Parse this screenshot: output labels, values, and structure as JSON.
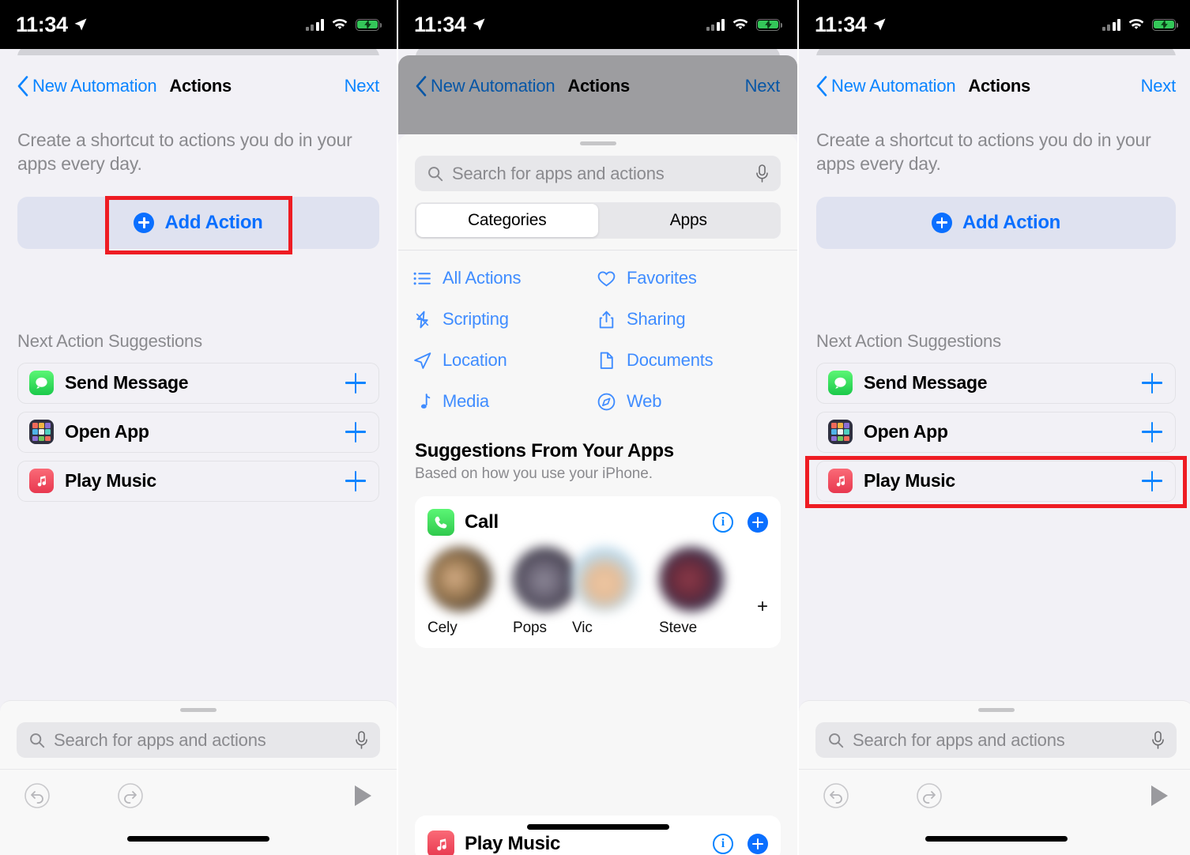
{
  "status_bar": {
    "time": "11:34",
    "icons": [
      "location-arrow-icon",
      "cellular-signal-icon",
      "wifi-icon",
      "battery-charging-icon"
    ]
  },
  "nav": {
    "back_label": "New Automation",
    "title": "Actions",
    "next_label": "Next"
  },
  "panel1": {
    "intro": "Create a shortcut to actions you do in your apps every day.",
    "add_action_label": "Add Action",
    "section_label": "Next Action Suggestions",
    "suggestions": [
      {
        "label": "Send Message",
        "icon": "messages-app-icon"
      },
      {
        "label": "Open App",
        "icon": "open-app-icon"
      },
      {
        "label": "Play Music",
        "icon": "music-app-icon"
      }
    ],
    "highlight": "add-action-button"
  },
  "panel2": {
    "search": {
      "placeholder": "Search for apps and actions"
    },
    "segments": [
      {
        "label": "Categories",
        "selected": true
      },
      {
        "label": "Apps",
        "selected": false
      }
    ],
    "categories": [
      {
        "label": "All Actions",
        "icon": "list-bullet-icon"
      },
      {
        "label": "Favorites",
        "icon": "heart-icon"
      },
      {
        "label": "Scripting",
        "icon": "scripting-icon"
      },
      {
        "label": "Sharing",
        "icon": "share-icon"
      },
      {
        "label": "Location",
        "icon": "location-arrow-icon"
      },
      {
        "label": "Documents",
        "icon": "document-icon"
      },
      {
        "label": "Media",
        "icon": "music-note-icon"
      },
      {
        "label": "Web",
        "icon": "safari-compass-icon"
      }
    ],
    "suggestions_heading": "Suggestions From Your Apps",
    "suggestions_sub": "Based on how you use your iPhone.",
    "app_card": {
      "title": "Call",
      "icon": "phone-app-icon",
      "info_label": "i",
      "contacts": [
        "Cely",
        "Pops",
        "Vic",
        "Steve"
      ],
      "more_label": "+"
    },
    "peek_card": {
      "title": "Play Music",
      "icon": "music-app-icon"
    }
  },
  "panel3": {
    "intro": "Create a shortcut to actions you do in your apps every day.",
    "add_action_label": "Add Action",
    "section_label": "Next Action Suggestions",
    "suggestions": [
      {
        "label": "Send Message",
        "icon": "messages-app-icon"
      },
      {
        "label": "Open App",
        "icon": "open-app-icon"
      },
      {
        "label": "Play Music",
        "icon": "music-app-icon"
      }
    ],
    "highlight": "play-music-row"
  },
  "bottom": {
    "search_placeholder": "Search for apps and actions",
    "toolbar_icons": [
      "undo-icon",
      "redo-icon",
      "play-icon"
    ]
  },
  "colors": {
    "accent_blue": "#0a84ff",
    "highlight_red": "#ee1c23",
    "sheet_bg": "#f2f1f6",
    "add_action_bg": "#dfe2f0",
    "music_red": "#e8384f",
    "messages_green": "#1bc94a",
    "battery_green": "#34c759"
  }
}
